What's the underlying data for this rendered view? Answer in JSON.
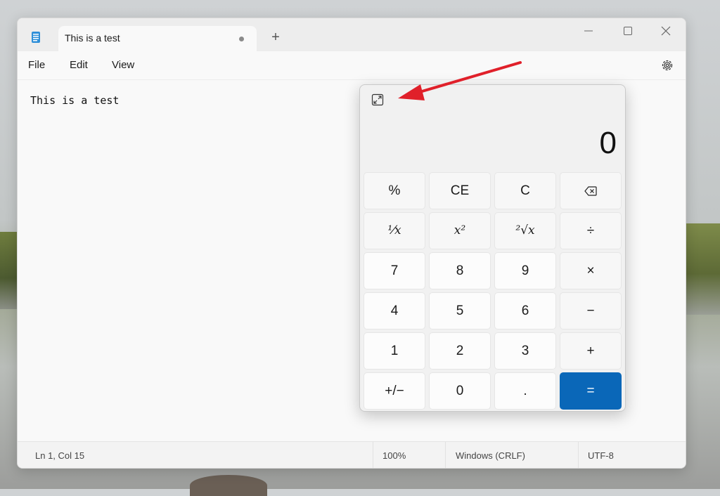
{
  "tab": {
    "title": "This is a test"
  },
  "titlebar": {
    "new_tab": "+"
  },
  "menu": {
    "file": "File",
    "edit": "Edit",
    "view": "View"
  },
  "editor": {
    "content": "This is a test"
  },
  "status": {
    "position": "Ln 1, Col 15",
    "zoom": "100%",
    "line_ending": "Windows (CRLF)",
    "encoding": "UTF-8"
  },
  "calculator": {
    "display": "0",
    "keys": [
      "%",
      "CE",
      "C",
      "⌫",
      "¹⁄x",
      "x²",
      "²√x",
      "÷",
      "7",
      "8",
      "9",
      "×",
      "4",
      "5",
      "6",
      "−",
      "1",
      "2",
      "3",
      "+",
      "+/−",
      "0",
      ".",
      "="
    ]
  },
  "icons": {
    "app": "notepad-icon",
    "settings": "gear-icon",
    "expand": "expand-icon",
    "backspace": "backspace-icon"
  },
  "colors": {
    "equals_key": "#0a67b8",
    "annotation_arrow": "#e0202a"
  }
}
